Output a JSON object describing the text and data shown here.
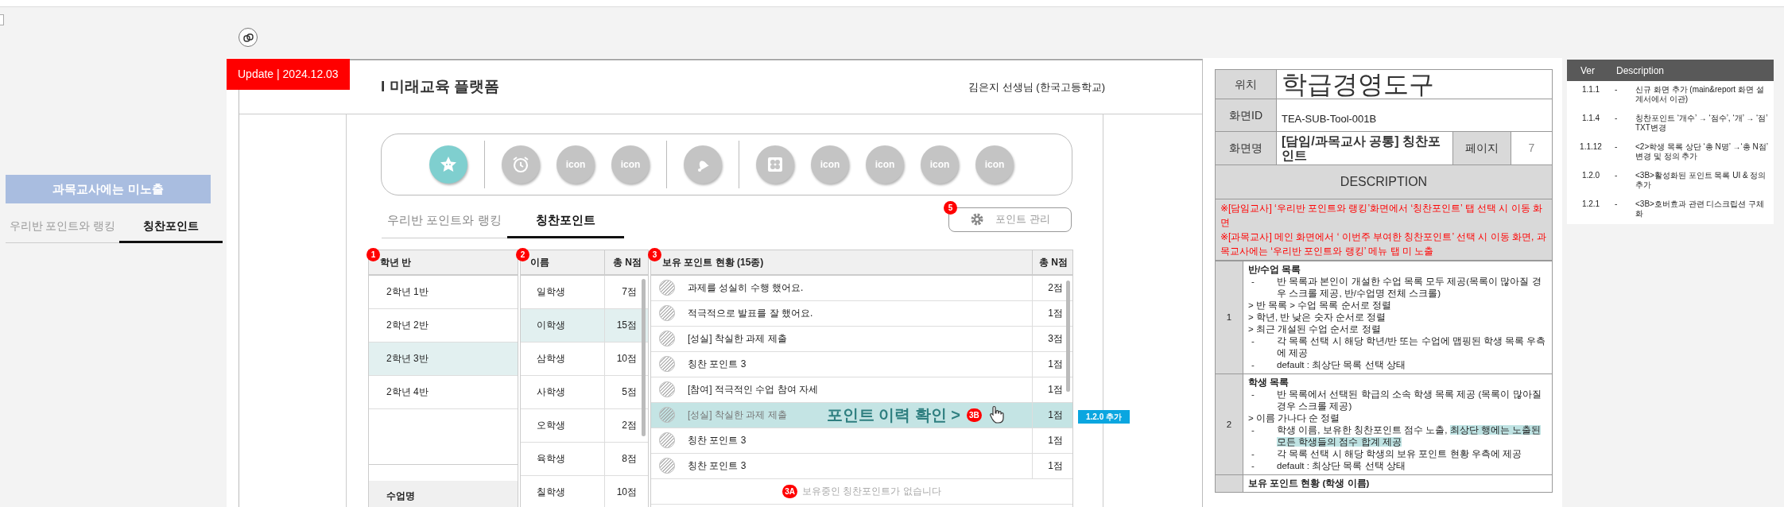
{
  "update_badge": "Update | 2024.12.03",
  "side_preview": {
    "note": "과목교사에는 미노출",
    "tabs": [
      {
        "label": "우리반 포인트와 랭킹",
        "selected": false
      },
      {
        "label": "칭찬포인트",
        "selected": true
      }
    ]
  },
  "mockup": {
    "header_title": "I 미래교육 플랫폼",
    "user": "김은지 선생님 (한국고등학교)",
    "icon_bar": [
      {
        "kind": "star",
        "selected": true
      },
      {
        "kind": "divider"
      },
      {
        "kind": "alarm",
        "selected": false
      },
      {
        "kind": "text",
        "label": "icon",
        "selected": false
      },
      {
        "kind": "text",
        "label": "icon",
        "selected": false
      },
      {
        "kind": "divider"
      },
      {
        "kind": "bell",
        "selected": false
      },
      {
        "kind": "divider"
      },
      {
        "kind": "clover",
        "selected": false
      },
      {
        "kind": "text",
        "label": "icon",
        "selected": false
      },
      {
        "kind": "text",
        "label": "icon",
        "selected": false
      },
      {
        "kind": "text",
        "label": "icon",
        "selected": false
      },
      {
        "kind": "text",
        "label": "icon",
        "selected": false
      }
    ],
    "tabs": [
      {
        "label": "우리반 포인트와 랭킹",
        "selected": false
      },
      {
        "label": "칭찬포인트",
        "selected": true
      }
    ],
    "manage_button": {
      "label": "포인트 관리",
      "marker": "5"
    },
    "class_list": {
      "marker": "1",
      "header": "학년 반",
      "footer_header": "수업명",
      "rows": [
        {
          "label": "2학년 1반",
          "selected": false
        },
        {
          "label": "2학년 2반",
          "selected": false
        },
        {
          "label": "2학년 3반",
          "selected": true
        },
        {
          "label": "2학년 4반",
          "selected": false
        }
      ]
    },
    "students": {
      "marker": "2",
      "columns": [
        "이름",
        "총 N점"
      ],
      "rows": [
        {
          "name": "일학생",
          "points": "7점",
          "selected": false
        },
        {
          "name": "이학생",
          "points": "15점",
          "selected": true
        },
        {
          "name": "삼학생",
          "points": "10점",
          "selected": false
        },
        {
          "name": "사학생",
          "points": "5점",
          "selected": false
        },
        {
          "name": "오학생",
          "points": "2점",
          "selected": false
        },
        {
          "name": "육학생",
          "points": "8점",
          "selected": false
        },
        {
          "name": "칠학생",
          "points": "10점",
          "selected": false
        }
      ]
    },
    "points": {
      "marker": "3",
      "columns": [
        "보유 포인트 현황 (15종)",
        "총 N점"
      ],
      "rows": [
        {
          "label": "과제를 성실히 수행 했어요.",
          "points": "2점",
          "selected": false
        },
        {
          "label": "적극적으로 발표를 잘 했어요.",
          "points": "1점",
          "selected": false
        },
        {
          "label": "[성실] 착실한 과제 제출",
          "points": "3점",
          "selected": false
        },
        {
          "label": "칭찬 포인트 3",
          "points": "1점",
          "selected": false
        },
        {
          "label": "[참여] 적극적인 수업 참여 자세",
          "points": "1점",
          "selected": false
        },
        {
          "label": "[성실] 착실한 과제 제출",
          "points": "1점",
          "selected": true
        },
        {
          "label": "칭찬 포인트 3",
          "points": "1점",
          "selected": false
        },
        {
          "label": "칭찬 포인트 3",
          "points": "1점",
          "selected": false
        }
      ],
      "hover": {
        "text": "포인트 이력 확인 >",
        "marker": "3B",
        "tag": "1.2.0 추가"
      },
      "empty": {
        "marker": "3A",
        "text": "보유중인 칭찬포인트가 없습니다"
      }
    }
  },
  "spec": {
    "location_label": "위치",
    "location": "학급경영도구",
    "screen_id_label": "화면ID",
    "screen_id": "TEA-SUB-Tool-001B",
    "screen_name_label": "화면명",
    "screen_name": "[담임/과목교사 공통] 칭찬포인트",
    "page_label": "페이지",
    "page": "7",
    "description_header": "DESCRIPTION",
    "notes": [
      "※[담임교사] ‘우리반 포인트와 랭킹’화면에서 ‘칭찬포인트’ 탭 선택 시 이동 화면",
      "※[과목교사] 메인 화면에서 ‘ 이번주 부여한 칭찬포인트’ 선택 시 이동 화면, 과목교사에는 ‘우리반 포인트와 랭킹’ 메뉴 탭 미 노출"
    ],
    "items": [
      {
        "number": "1",
        "title": "반/수업 목록",
        "lines": [
          {
            "bullet": "-",
            "text": "반 목록과 본인이 개설한 수업 목록 모두 제공(목록이 많아질 경우 스크롤 제공, 반/수업명 전체 스크롤)"
          },
          {
            "text": "> 반 목록 > 수업 목록 순서로 정렬"
          },
          {
            "text": "> 학년, 반 낮은 숫자 순서로 정렬"
          },
          {
            "text": "> 최근 개설된 수업 순서로 정렬"
          },
          {
            "bullet": "-",
            "text": "각 목록 선택 시 해당 학년/반 또는 수업에 맵핑된 학생 목록 우측에 제공"
          },
          {
            "bullet": "-",
            "text": "default : 최상단 목록 선택 상태"
          }
        ]
      },
      {
        "number": "2",
        "title": "학생 목록",
        "lines": [
          {
            "bullet": "-",
            "text": "반 목록에서 선택된 학급의 소속 학생 목록 제공 (목록이 많아질 경우 스크롤 제공)"
          },
          {
            "text": " > 이름 가나다 순 정렬"
          },
          {
            "bullet": "-",
            "text": "학생 이름, 보유한 칭찬포인트 점수 노출,",
            "highlight": "최상단 행에는 노출된 모든 학생들의 점수 합계 제공"
          },
          {
            "bullet": "-",
            "text": "각 목록 선택 시 해당 학생의 보유 포인트 현황 우측에 제공"
          },
          {
            "bullet": "-",
            "text": "default : 최상단 목록 선택 상태"
          }
        ]
      },
      {
        "title": "보유 포인트 현황 (학생 이름)"
      }
    ]
  },
  "versions": {
    "columns": [
      "Ver",
      "Description"
    ],
    "rows": [
      {
        "ver": "1.1.1",
        "dash": "-",
        "text": "신규 화면 추가 (main&report 화면 설계서에서 이관)"
      },
      {
        "ver": "1.1.4",
        "dash": "-",
        "text": "칭찬포인트 ‘개수’ → ‘점수’, ‘개’ → ‘점’ TXT변경"
      },
      {
        "ver": "1.1.12",
        "dash": "-",
        "text": "<2>학생 목록 상단 ‘총 N명’ →‘총 N점’ 변경 및 정의 추가"
      },
      {
        "ver": "1.2.0",
        "dash": "-",
        "text": "<3B>활성화된 포인트 목록 UI & 정의 추가"
      },
      {
        "ver": "1.2.1",
        "dash": "-",
        "text": "<3B>호버효과 관련 디스크립션 구체화"
      }
    ]
  }
}
